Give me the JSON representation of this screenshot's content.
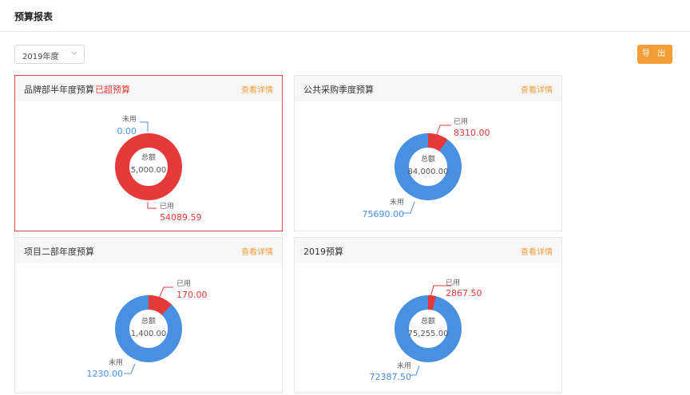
{
  "page": {
    "title": "预算报表"
  },
  "filter": {
    "year_value": "2019年度"
  },
  "toolbar": {
    "export_label": "导 出"
  },
  "labels": {
    "center": "总额",
    "unused": "未用",
    "used": "已用",
    "link": "查看详情"
  },
  "colors": {
    "used": "#e63a3a",
    "unused": "#4a90e2",
    "accent": "#f39c38"
  },
  "cards": [
    {
      "title": "品牌部半年度预算",
      "status": "已超预算",
      "total": "5,000.00",
      "used": "54089.59",
      "unused": "0.00",
      "used_fraction": 1.0
    },
    {
      "title": "公共采购季度预算",
      "status": "",
      "total": "84,000.00",
      "used": "8310.00",
      "unused": "75690.00",
      "used_fraction": 0.099
    },
    {
      "title": "项目二部年度预算",
      "status": "",
      "total": "1,400.00",
      "used": "170.00",
      "unused": "1230.00",
      "used_fraction": 0.121
    },
    {
      "title": "2019预算",
      "status": "",
      "total": "75,255.00",
      "used": "2867.50",
      "unused": "72387.50",
      "used_fraction": 0.038
    }
  ]
}
